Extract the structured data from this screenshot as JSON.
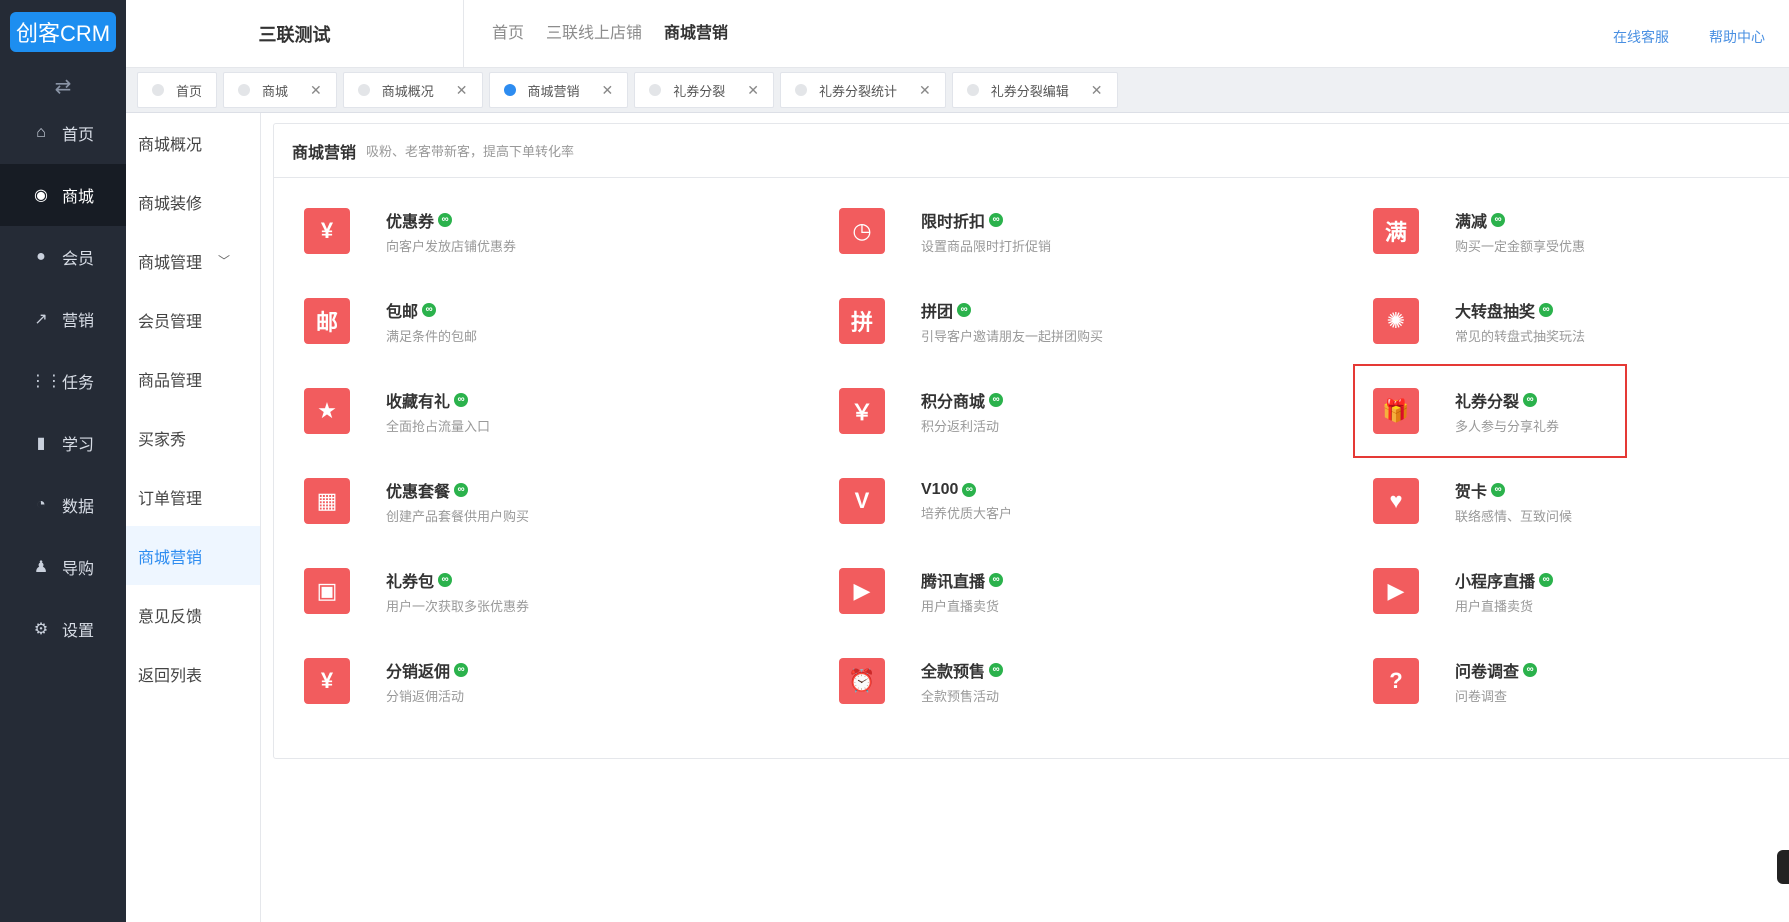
{
  "brand": {
    "logo": "创客CRM"
  },
  "sidebar": {
    "toggle_icon": "swap-arrows-icon",
    "items": [
      {
        "label": "首页",
        "icon": "home-icon"
      },
      {
        "label": "商城",
        "icon": "shop-icon",
        "active": true
      },
      {
        "label": "会员",
        "icon": "user-icon"
      },
      {
        "label": "营销",
        "icon": "trend-icon"
      },
      {
        "label": "任务",
        "icon": "grid-icon"
      },
      {
        "label": "学习",
        "icon": "book-icon"
      },
      {
        "label": "数据",
        "icon": "pie-icon"
      },
      {
        "label": "导购",
        "icon": "team-icon"
      },
      {
        "label": "设置",
        "icon": "gear-icon"
      }
    ]
  },
  "header": {
    "shop_name": "三联测试",
    "breadcrumb": [
      "首页",
      "三联线上店铺",
      "商城营销"
    ],
    "links": [
      "在线客服",
      "帮助中心"
    ]
  },
  "tabs": [
    {
      "label": "首页",
      "closable": false
    },
    {
      "label": "商城",
      "closable": true
    },
    {
      "label": "商城概况",
      "closable": true
    },
    {
      "label": "商城营销",
      "closable": true,
      "active": true
    },
    {
      "label": "礼券分裂",
      "closable": true
    },
    {
      "label": "礼券分裂统计",
      "closable": true
    },
    {
      "label": "礼券分裂编辑",
      "closable": true
    }
  ],
  "submenu": [
    {
      "label": "商城概况"
    },
    {
      "label": "商城装修"
    },
    {
      "label": "商城管理",
      "expandable": true
    },
    {
      "label": "会员管理"
    },
    {
      "label": "商品管理"
    },
    {
      "label": "买家秀"
    },
    {
      "label": "订单管理"
    },
    {
      "label": "商城营销",
      "active": true
    },
    {
      "label": "意见反馈"
    },
    {
      "label": "返回列表"
    }
  ],
  "panel": {
    "title": "商城营销",
    "subtitle": "吸粉、老客带新客，提高下单转化率"
  },
  "tools": [
    {
      "name": "优惠券",
      "desc": "向客户发放店铺优惠券",
      "icon": "ticket-icon",
      "glyph": "¥"
    },
    {
      "name": "限时折扣",
      "desc": "设置商品限时打折促销",
      "icon": "clock-icon",
      "glyph": "◷"
    },
    {
      "name": "满减",
      "desc": "购买一定金额享受优惠",
      "icon": "full-reduce-icon",
      "glyph": "满"
    },
    {
      "name": "包邮",
      "desc": "满足条件的包邮",
      "icon": "free-shipping-icon",
      "glyph": "邮"
    },
    {
      "name": "拼团",
      "desc": "引导客户邀请朋友一起拼团购买",
      "icon": "group-buy-icon",
      "glyph": "拼"
    },
    {
      "name": "大转盘抽奖",
      "desc": "常见的转盘式抽奖玩法",
      "icon": "wheel-icon",
      "glyph": "✺"
    },
    {
      "name": "收藏有礼",
      "desc": "全面抢占流量入口",
      "icon": "star-icon",
      "glyph": "★"
    },
    {
      "name": "积分商城",
      "desc": "积分返利活动",
      "icon": "money-bag-icon",
      "glyph": "￥"
    },
    {
      "name": "礼券分裂",
      "desc": "多人参与分享礼券",
      "icon": "gift-icon",
      "glyph": "🎁",
      "highlight": true
    },
    {
      "name": "优惠套餐",
      "desc": "创建产品套餐供用户购买",
      "icon": "package-icon",
      "glyph": "▦"
    },
    {
      "name": "V100",
      "desc": "培养优质大客户",
      "icon": "v100-icon",
      "glyph": "V"
    },
    {
      "name": "贺卡",
      "desc": "联络感情、互致问候",
      "icon": "card-icon",
      "glyph": "♥"
    },
    {
      "name": "礼券包",
      "desc": "用户一次获取多张优惠券",
      "icon": "coupon-pack-icon",
      "glyph": "▣"
    },
    {
      "name": "腾讯直播",
      "desc": "用户直播卖货",
      "icon": "live-icon",
      "glyph": "▶"
    },
    {
      "name": "小程序直播",
      "desc": "用户直播卖货",
      "icon": "mini-live-icon",
      "glyph": "▶"
    },
    {
      "name": "分销返佣",
      "desc": "分销返佣活动",
      "icon": "commission-icon",
      "glyph": "¥"
    },
    {
      "name": "全款预售",
      "desc": "全款预售活动",
      "icon": "alarm-icon",
      "glyph": "⏰"
    },
    {
      "name": "问卷调查",
      "desc": "问卷调查",
      "icon": "survey-icon",
      "glyph": "?"
    }
  ],
  "colors": {
    "sidebar_bg": "#252b36",
    "accent": "#2d8cf0",
    "tool_icon_bg": "#f25c5e",
    "highlight_border": "#e53935",
    "link_badge": "#2bb24c"
  }
}
